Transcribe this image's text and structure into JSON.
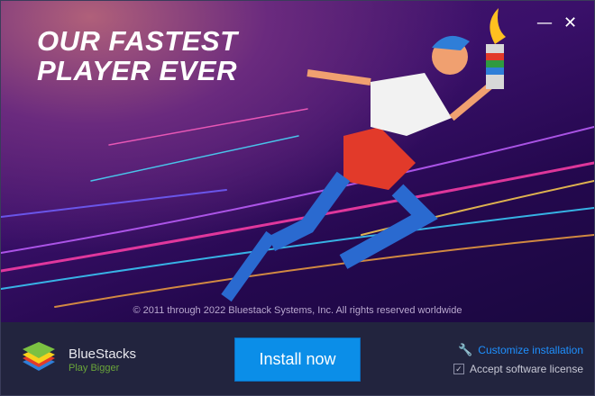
{
  "banner": {
    "headline_line1": "OUR FASTEST",
    "headline_line2": "PLAYER EVER",
    "copyright": "© 2011 through 2022 Bluestack Systems, Inc. All rights reserved worldwide"
  },
  "window_controls": {
    "minimize": "—",
    "close": "✕"
  },
  "footer": {
    "brand": "BlueStacks",
    "tagline": "Play Bigger",
    "install_label": "Install now",
    "customize_label": "Customize installation",
    "accept_label": "Accept software license",
    "accept_checked": true
  },
  "colors": {
    "accent": "#0b8ee8",
    "footer_bg": "#22243e",
    "tagline": "#6aa53a",
    "link": "#1e90ff"
  }
}
